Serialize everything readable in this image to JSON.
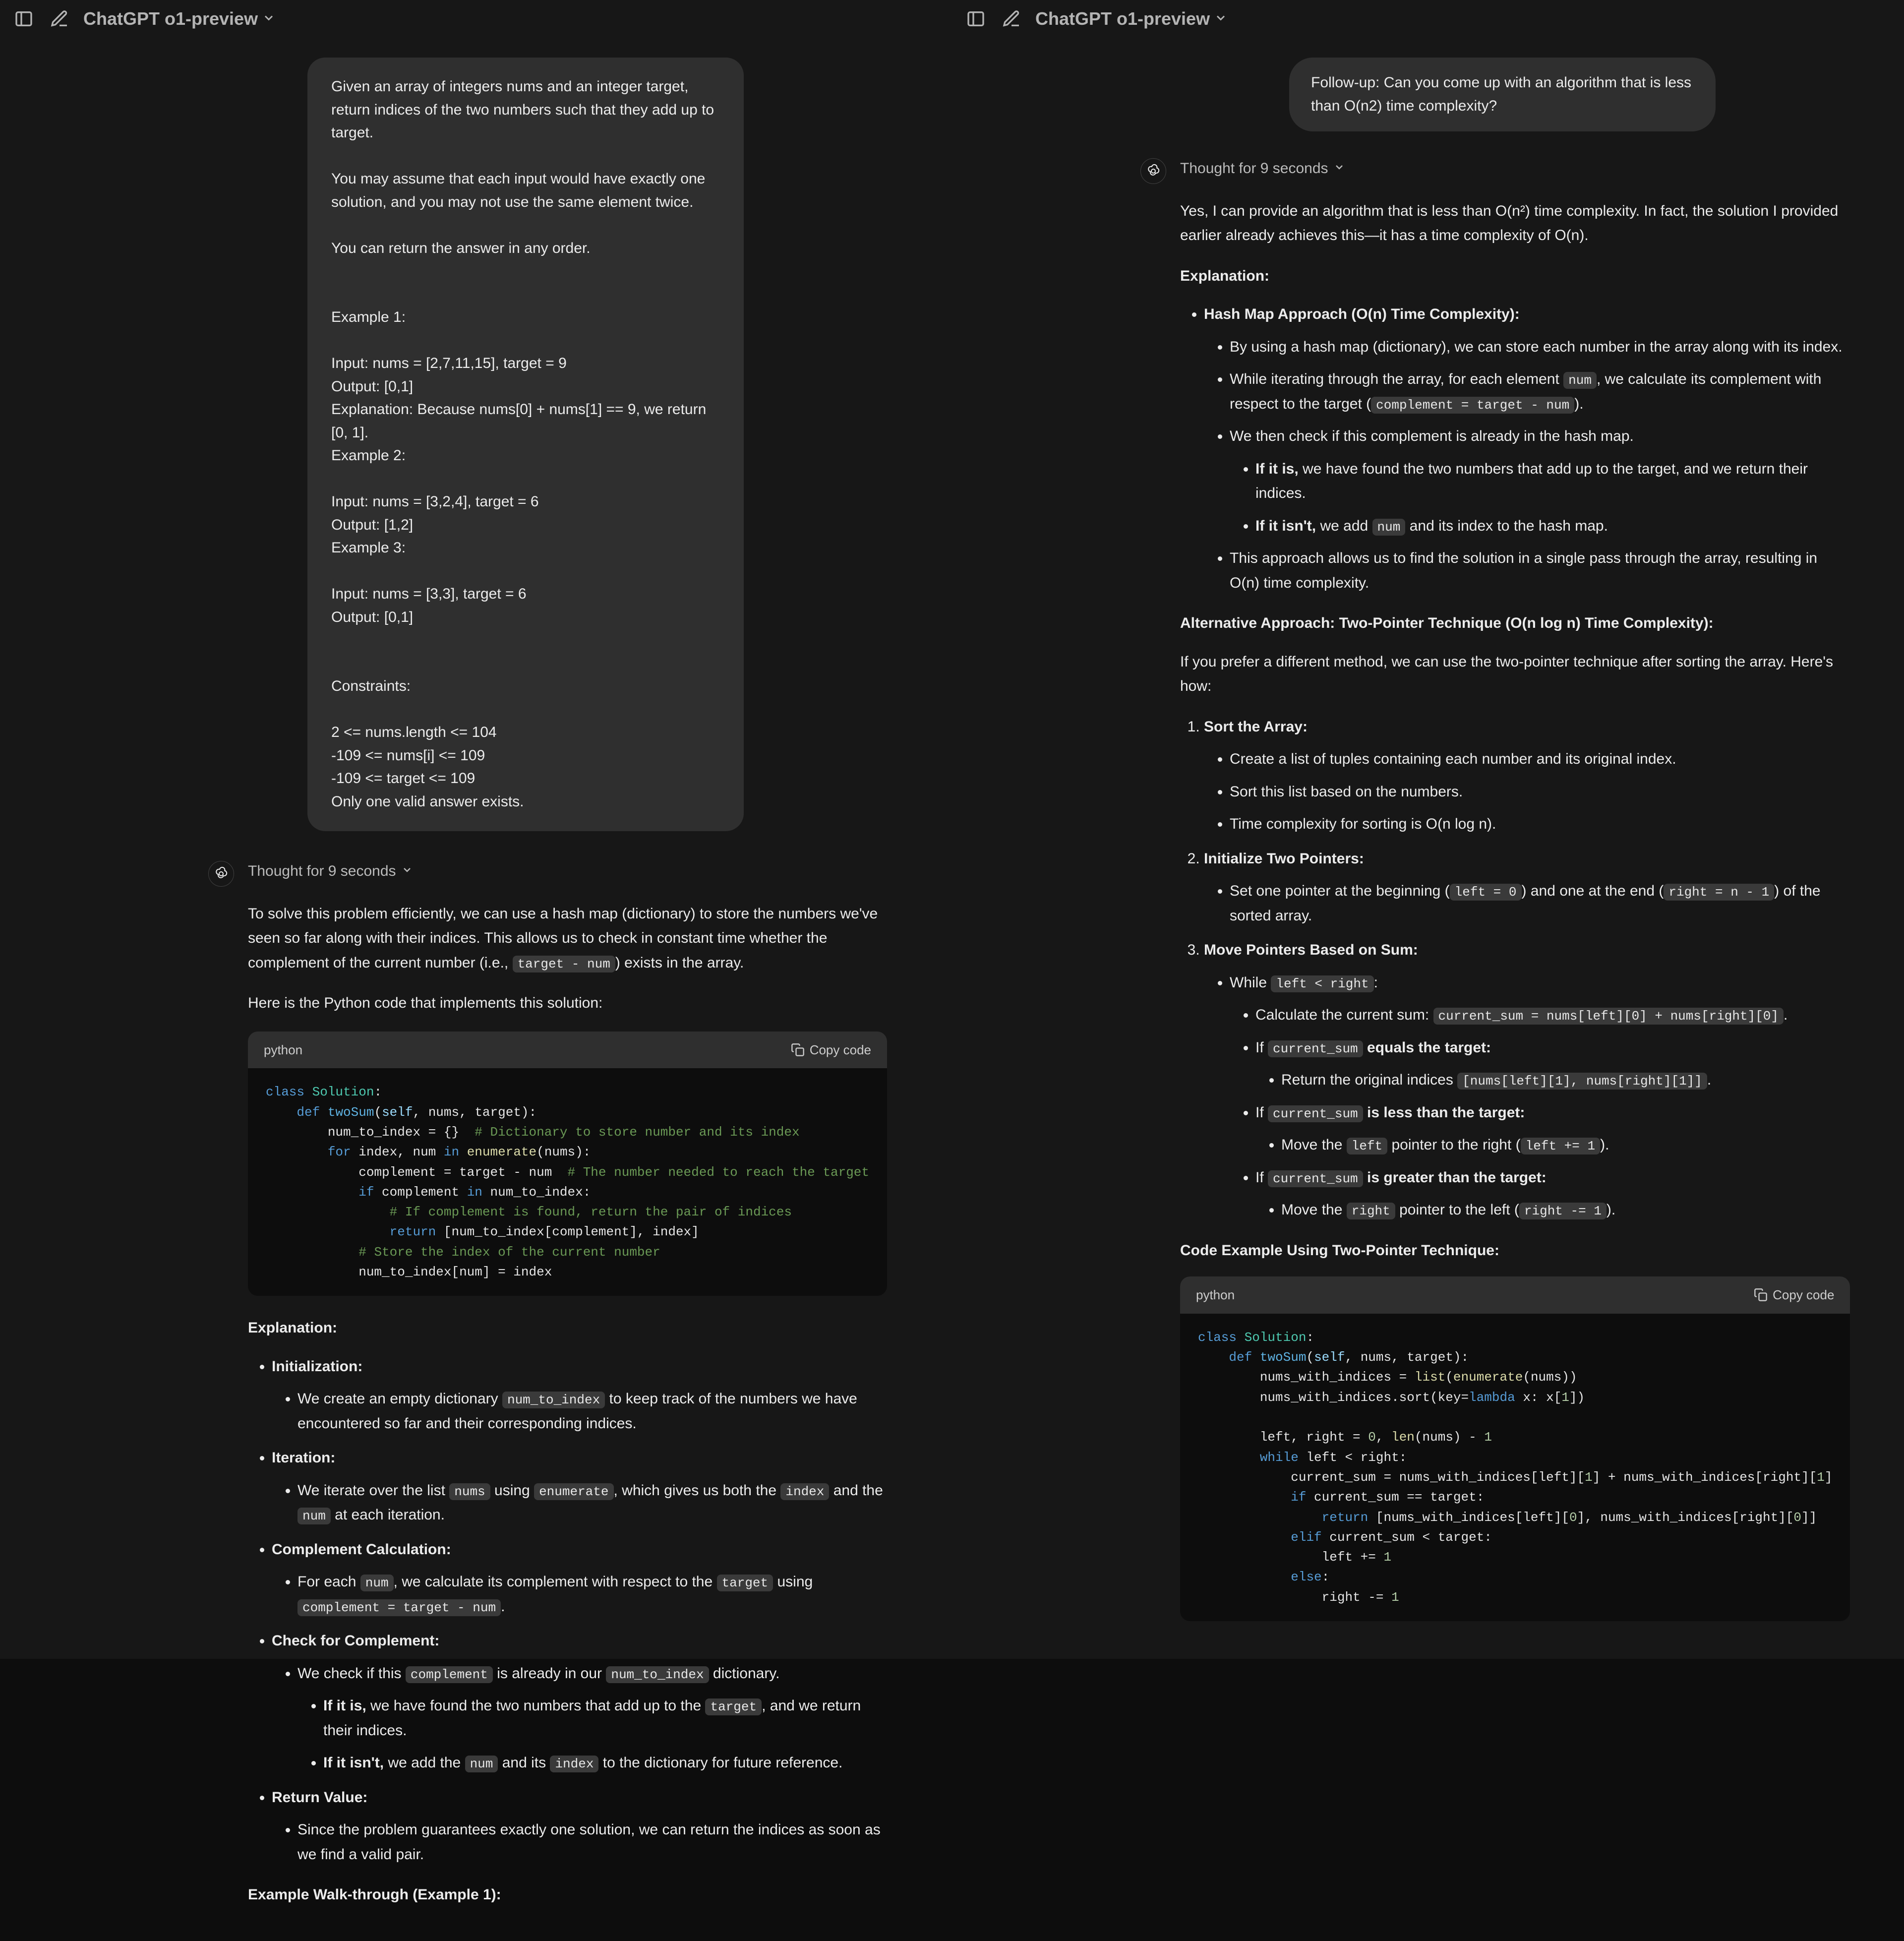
{
  "model_label": "ChatGPT o1-preview",
  "left": {
    "user_prompt": "Given an array of integers nums and an integer target, return indices of the two numbers such that they add up to target.\n\nYou may assume that each input would have exactly one solution, and you may not use the same element twice.\n\nYou can return the answer in any order.\n\n\nExample 1:\n\nInput: nums = [2,7,11,15], target = 9\nOutput: [0,1]\nExplanation: Because nums[0] + nums[1] == 9, we return [0, 1].\nExample 2:\n\nInput: nums = [3,2,4], target = 6\nOutput: [1,2]\nExample 3:\n\nInput: nums = [3,3], target = 6\nOutput: [0,1]\n\n\nConstraints:\n\n2 <= nums.length <= 104\n-109 <= nums[i] <= 109\n-109 <= target <= 109\nOnly one valid answer exists.",
    "thought": "Thought for 9 seconds",
    "intro_a": "To solve this problem efficiently, we can use a hash map (dictionary) to store the numbers we've seen so far along with their indices. This allows us to check in constant time whether the complement of the current number (i.e., ",
    "intro_code": "target - num",
    "intro_b": ") exists in the array.",
    "here_is": "Here is the Python code that implements this solution:",
    "code_lang": "python",
    "copy_label": "Copy code",
    "expl_heading": "Explanation:",
    "init_h": "Initialization:",
    "init_a": "We create an empty dictionary ",
    "init_code": "num_to_index",
    "init_b": " to keep track of the numbers we have encountered so far and their corresponding indices.",
    "iter_h": "Iteration:",
    "iter_a": "We iterate over the list ",
    "iter_code1": "nums",
    "iter_b": " using ",
    "iter_code2": "enumerate",
    "iter_c": ", which gives us both the ",
    "iter_code3": "index",
    "iter_d": " and the ",
    "iter_code4": "num",
    "iter_e": " at each iteration.",
    "comp_h": "Complement Calculation:",
    "comp_a": "For each ",
    "comp_code1": "num",
    "comp_b": ", we calculate its complement with respect to the ",
    "comp_code2": "target",
    "comp_c": " using ",
    "comp_code3": "complement = target - num",
    "comp_d": ".",
    "check_h": "Check for Complement:",
    "check_a": "We check if this ",
    "check_code1": "complement",
    "check_b": " is already in our ",
    "check_code2": "num_to_index",
    "check_c": " dictionary.",
    "ifis": "If it is,",
    "ifis_a": " we have found the two numbers that add up to the ",
    "ifis_code": "target",
    "ifis_b": ", and we return their indices.",
    "ifisnt": "If it isn't,",
    "ifisnt_a": " we add the ",
    "ifisnt_code1": "num",
    "ifisnt_b": " and its ",
    "ifisnt_code2": "index",
    "ifisnt_c": " to the dictionary for future reference.",
    "ret_h": "Return Value:",
    "ret_a": "Since the problem guarantees exactly one solution, we can return the indices as soon as we find a valid pair.",
    "walk_h": "Example Walk-through (Example 1):"
  },
  "right": {
    "user_prompt": "Follow-up: Can you come up with an algorithm that is less than O(n2) time complexity?",
    "thought": "Thought for 9 seconds",
    "intro": "Yes, I can provide an algorithm that is less than O(n²) time complexity. In fact, the solution I provided earlier already achieves this—it has a time complexity of O(n).",
    "expl_heading": "Explanation:",
    "hash_h": "Hash Map Approach (O(n) Time Complexity):",
    "hash_a": "By using a hash map (dictionary), we can store each number in the array along with its index.",
    "hash_b_a": "While iterating through the array, for each element ",
    "hash_b_code1": "num",
    "hash_b_b": ", we calculate its complement with respect to the target (",
    "hash_b_code2": "complement = target - num",
    "hash_b_c": ").",
    "hash_c": "We then check if this complement is already in the hash map.",
    "hash_ifis": "If it is,",
    "hash_ifis_a": " we have found the two numbers that add up to the target, and we return their indices.",
    "hash_ifisnt": "If it isn't,",
    "hash_ifisnt_a": " we add ",
    "hash_ifisnt_code": "num",
    "hash_ifisnt_b": " and its index to the hash map.",
    "hash_d": "This approach allows us to find the solution in a single pass through the array, resulting in O(n) time complexity.",
    "alt_h": "Alternative Approach: Two-Pointer Technique (O(n log n) Time Complexity):",
    "alt_intro": "If you prefer a different method, we can use the two-pointer technique after sorting the array. Here's how:",
    "sort_h": "Sort the Array:",
    "sort_a": "Create a list of tuples containing each number and its original index.",
    "sort_b": "Sort this list based on the numbers.",
    "sort_c": "Time complexity for sorting is O(n log n).",
    "init_h": "Initialize Two Pointers:",
    "init_a": "Set one pointer at the beginning (",
    "init_code1": "left = 0",
    "init_b": ") and one at the end (",
    "init_code2": "right = n - 1",
    "init_c": ") of the sorted array.",
    "move_h": "Move Pointers Based on Sum:",
    "move_while_a": "While ",
    "move_while_code": "left < right",
    "move_while_b": ":",
    "move_calc_a": "Calculate the current sum: ",
    "move_calc_code": "current_sum = nums[left][0] + nums[right][0]",
    "move_calc_b": ".",
    "move_eq_a": "If ",
    "move_eq_code": "current_sum",
    "move_eq_b": " equals the target:",
    "move_eq_ret_a": "Return the original indices ",
    "move_eq_ret_code": "[nums[left][1], nums[right][1]]",
    "move_eq_ret_b": ".",
    "move_lt_a": "If ",
    "move_lt_code": "current_sum",
    "move_lt_b": " is less than the target:",
    "move_lt_act_a": "Move the ",
    "move_lt_act_code1": "left",
    "move_lt_act_b": " pointer to the right (",
    "move_lt_act_code2": "left += 1",
    "move_lt_act_c": ").",
    "move_gt_a": "If ",
    "move_gt_code": "current_sum",
    "move_gt_b": " is greater than the target:",
    "move_gt_act_a": "Move the ",
    "move_gt_act_code1": "right",
    "move_gt_act_b": " pointer to the left (",
    "move_gt_act_code2": "right -= 1",
    "move_gt_act_c": ").",
    "code_h": "Code Example Using Two-Pointer Technique:",
    "code_lang": "python",
    "copy_label": "Copy code"
  }
}
